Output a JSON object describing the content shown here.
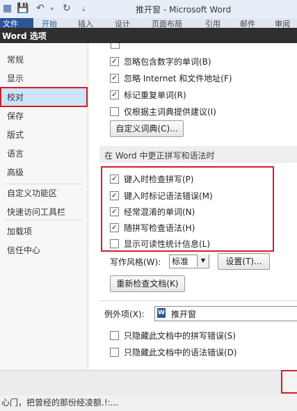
{
  "window": {
    "app_title": "推开窗 - Microsoft Word",
    "file_tab": "文件",
    "ribbon_tabs": [
      "开始",
      "插入",
      "设计",
      "页面布局",
      "引用",
      "邮件",
      "审阅"
    ]
  },
  "dialog": {
    "title": "Word 选项"
  },
  "sidebar": {
    "items": [
      "常规",
      "显示",
      "校对",
      "保存",
      "版式",
      "语言",
      "高级",
      "自定义功能区",
      "快速访问工具栏",
      "加载项",
      "信任中心"
    ],
    "selected": "校对"
  },
  "autocorrect_options": [
    {
      "label": "忽略包含数字的单词(B)",
      "checked": true
    },
    {
      "label": "忽略 Internet 和文件地址(F)",
      "checked": true
    },
    {
      "label": "标记重复单词(R)",
      "checked": true
    },
    {
      "label": "仅根据主词典提供建议(I)",
      "checked": false
    }
  ],
  "custom_dict_button": "自定义词典(C)...",
  "word_section": {
    "title": "在 Word 中更正拼写和语法时",
    "options": [
      {
        "label": "键入时检查拼写(P)",
        "checked": true
      },
      {
        "label": "键入时标记语法错误(M)",
        "checked": true
      },
      {
        "label": "经常混淆的单词(N)",
        "checked": true
      },
      {
        "label": "随拼写检查语法(H)",
        "checked": true
      },
      {
        "label": "显示可读性统计信息(L)",
        "checked": false
      }
    ],
    "writing_style_label": "写作风格(W):",
    "writing_style_value": "标准",
    "settings_button": "设置(T)...",
    "recheck_button": "重新检查文档(K)"
  },
  "exceptions": {
    "label": "例外项(X):",
    "value": "推开窗",
    "options": [
      {
        "label": "只隐藏此文档中的拼写错误(S)",
        "checked": false
      },
      {
        "label": "只隐藏此文档中的语法错误(D)",
        "checked": false
      }
    ]
  },
  "caption": "心门，把曾经的那份经凌额.!:...",
  "accent_colors": {
    "word_blue": "#2b579a",
    "highlight_red": "#d0202a",
    "selected_bg": "#cfe3f7"
  }
}
